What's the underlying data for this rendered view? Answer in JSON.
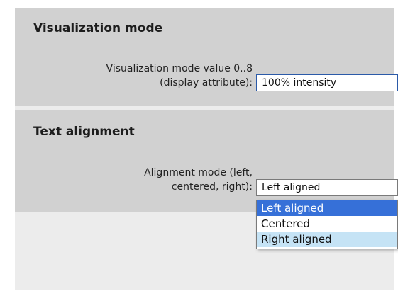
{
  "visualization_section": {
    "title": "Visualization mode",
    "label_line1": "Visualization mode value 0..8",
    "label_line2": "(display attribute):",
    "value": "100% intensity"
  },
  "text_alignment_section": {
    "title": "Text alignment",
    "label_line1": "Alignment mode (left,",
    "label_line2": "centered, right):",
    "value": "Left aligned",
    "options": [
      "Left aligned",
      "Centered",
      "Right aligned"
    ],
    "selected_option": "Left aligned",
    "hovered_option": "Right aligned"
  },
  "colors": {
    "section_bg": "#d1d1d1",
    "panel_bg": "#ececec",
    "selection": "#3670d8",
    "hover": "#c5e3f5"
  }
}
